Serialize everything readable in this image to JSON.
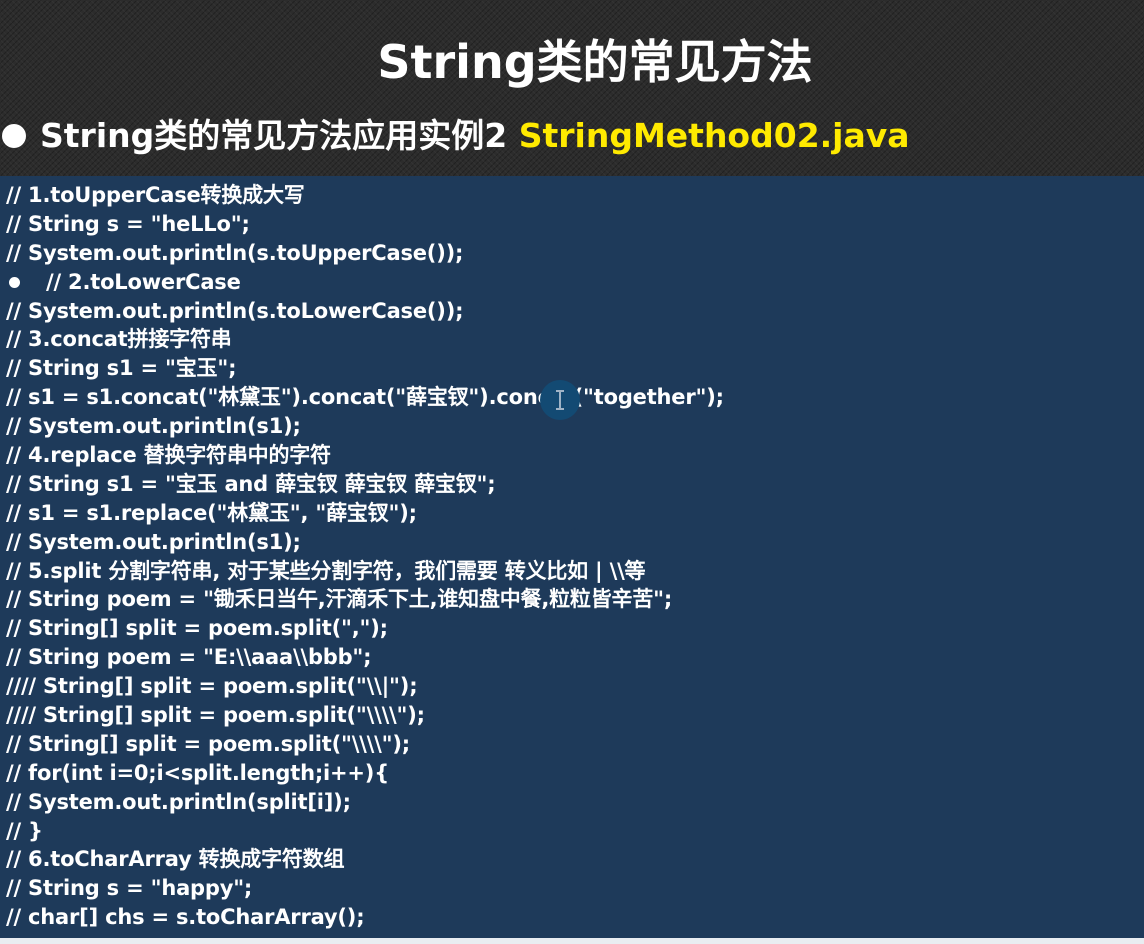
{
  "slide": {
    "title": "String类的常见方法",
    "subtitle_text": "String类的常见方法应用实例2 ",
    "subtitle_highlight": "StringMethod02.java",
    "colors": {
      "header_background": "#2c2c2c",
      "code_background": "#1e3a5a",
      "title_text": "#ffffff",
      "highlight_text": "#ffea00"
    }
  },
  "code": {
    "lines": [
      {
        "text": "// 1.toUpperCase转换成大写"
      },
      {
        "text": "// String s = \"heLLo\";"
      },
      {
        "text": "// System.out.println(s.toUpperCase());"
      },
      {
        "text": "// 2.toLowerCase",
        "bullet": true
      },
      {
        "text": "// System.out.println(s.toLowerCase());"
      },
      {
        "text": "// 3.concat拼接字符串"
      },
      {
        "text": "// String s1 = \"宝玉\";"
      },
      {
        "text": "// s1 = s1.concat(\"林黛玉\").concat(\"薛宝钗\").concat(\"together\");"
      },
      {
        "text": "// System.out.println(s1);"
      },
      {
        "text": "// 4.replace 替换字符串中的字符"
      },
      {
        "text": "// String s1 = \"宝玉 and 薛宝钗 薛宝钗 薛宝钗\";"
      },
      {
        "text": "// s1 = s1.replace(\"林黛玉\", \"薛宝钗\");"
      },
      {
        "text": "// System.out.println(s1);"
      },
      {
        "text": "// 5.split 分割字符串, 对于某些分割字符，我们需要 转义比如 | \\\\等"
      },
      {
        "text": "// String poem = \"锄禾日当午,汗滴禾下土,谁知盘中餐,粒粒皆辛苦\";"
      },
      {
        "text": "// String[] split = poem.split(\",\");"
      },
      {
        "text": "// String poem = \"E:\\\\aaa\\\\bbb\";"
      },
      {
        "text": "//// String[] split = poem.split(\"\\\\|\");"
      },
      {
        "text": "//// String[] split = poem.split(\"\\\\\\\\\");"
      },
      {
        "text": "// String[] split = poem.split(\"\\\\\\\\\");"
      },
      {
        "text": "// for(int i=0;i<split.length;i++){"
      },
      {
        "text": "// System.out.println(split[i]);"
      },
      {
        "text": "// }"
      },
      {
        "text": "// 6.toCharArray 转换成字符数组"
      },
      {
        "text": "// String s = \"happy\";"
      },
      {
        "text": "// char[] chs = s.toCharArray();"
      }
    ]
  },
  "cursor": {
    "icon": "text-cursor-icon"
  }
}
